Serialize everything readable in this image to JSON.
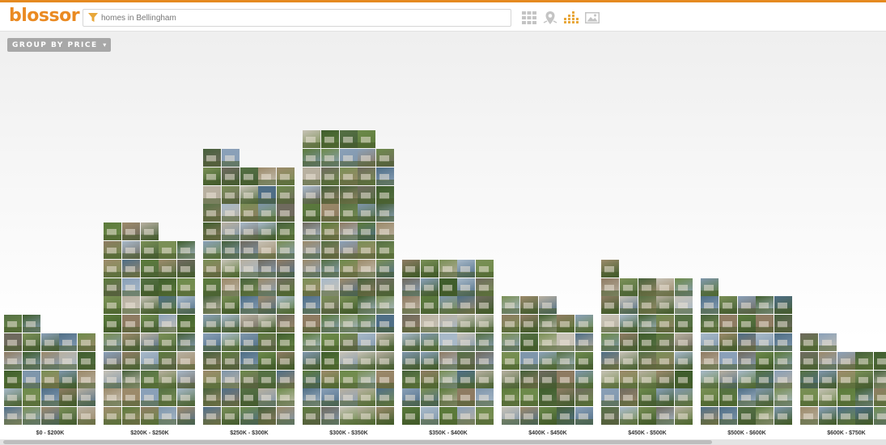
{
  "app": {
    "logo": "blossor"
  },
  "search": {
    "value": "homes in Bellingham"
  },
  "view_modes": [
    "grid-view-icon",
    "map-view-icon",
    "histogram-view-icon",
    "photo-view-icon"
  ],
  "colors": {
    "accent": "#e58a20",
    "active_view": "#e8a73a",
    "inactive_view": "#c4c4c4",
    "group_button": "#a8a8a8"
  },
  "group_button": {
    "label": "GROUP BY PRICE",
    "caret": "▾"
  },
  "chart_data": {
    "type": "bar",
    "categories": [
      "$0 - $200K",
      "$200K - $250K",
      "$250K - $300K",
      "$300K - $350K",
      "$350K - $400K",
      "$400K - $450K",
      "$450K - $500K",
      "$500K - $600K",
      "$600K - $750K"
    ],
    "values": [
      27,
      53,
      72,
      79,
      45,
      33,
      41,
      36,
      22
    ],
    "grid": false
  }
}
